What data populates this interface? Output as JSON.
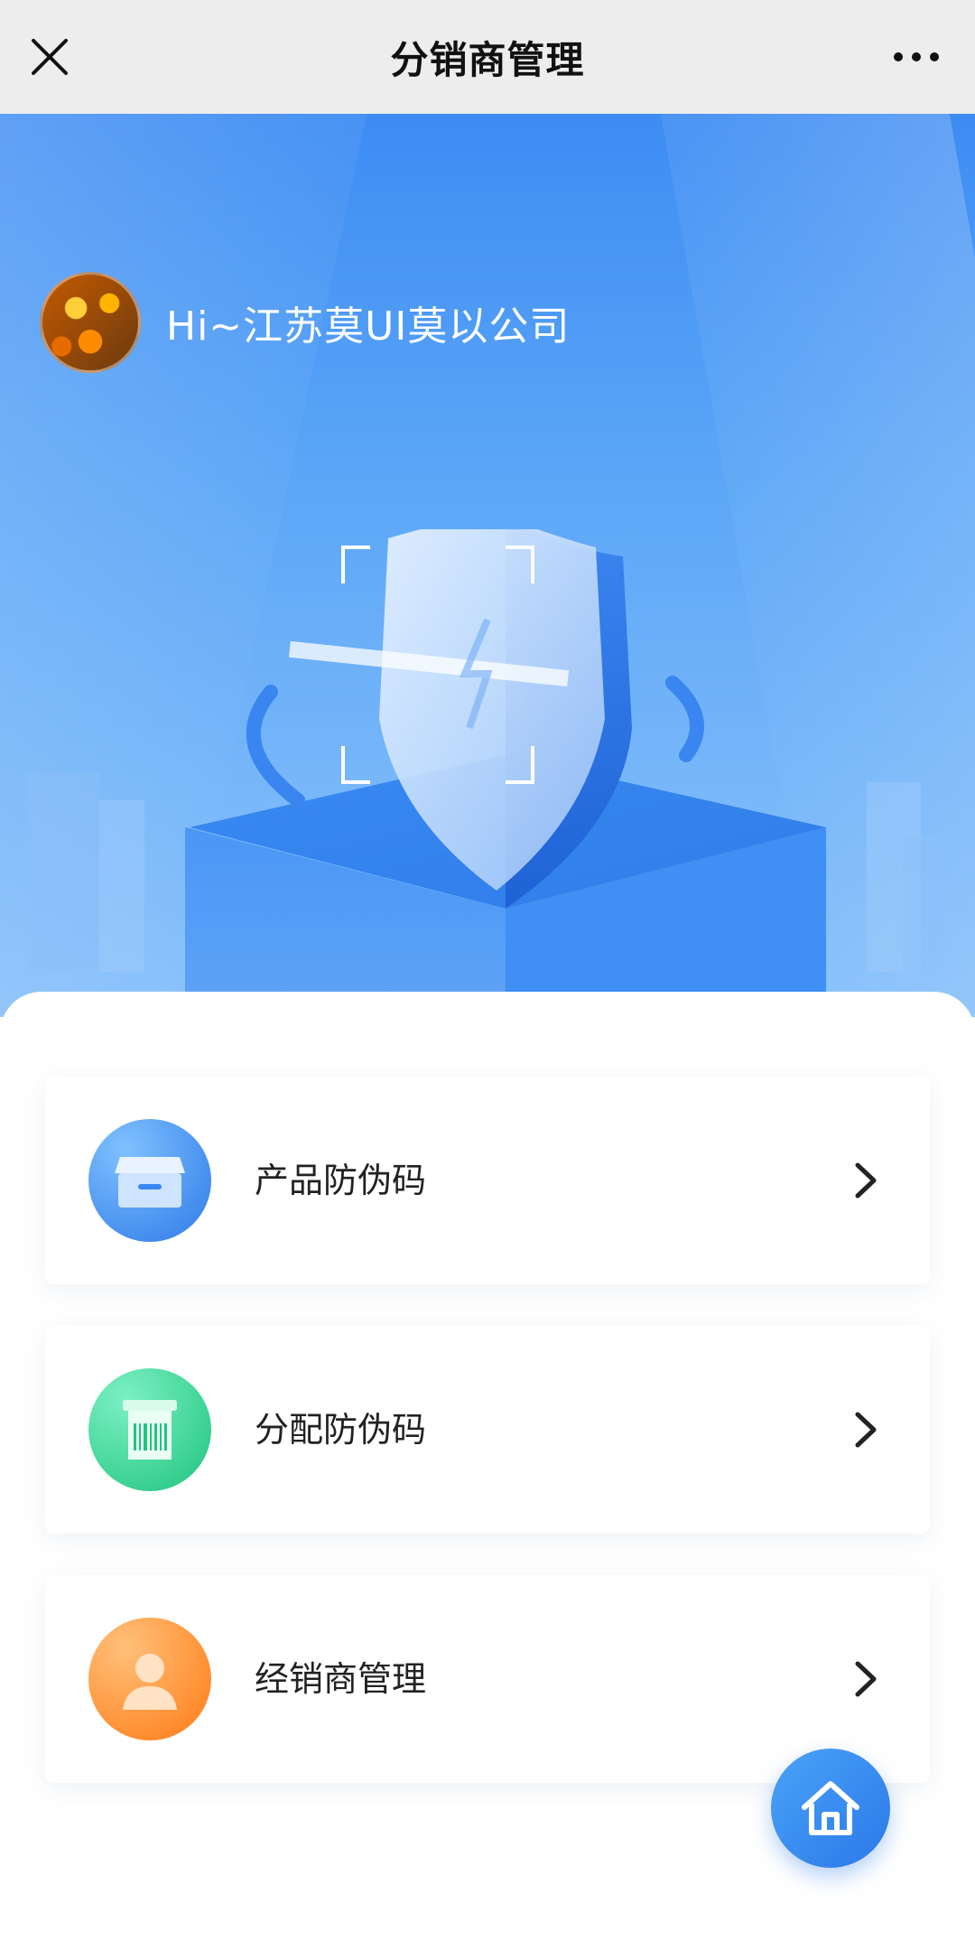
{
  "topbar": {
    "title": "分销商管理"
  },
  "greeting": {
    "text": "Hi~江苏莫UI莫以公司"
  },
  "menu": [
    {
      "label": "产品防伪码",
      "icon": "box-icon",
      "color": "#3a86f2"
    },
    {
      "label": "分配防伪码",
      "icon": "barcode-icon",
      "color": "#2fd08a"
    },
    {
      "label": "经销商管理",
      "icon": "user-icon",
      "color": "#ff8a1f"
    }
  ],
  "colors": {
    "accent": "#3d8cf3",
    "topbar_bg": "#ededed"
  }
}
